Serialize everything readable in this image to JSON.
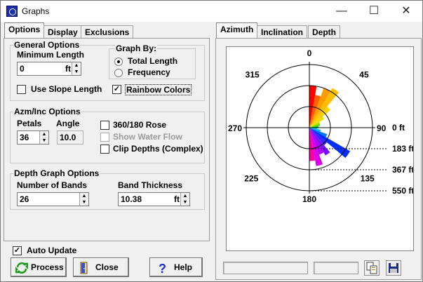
{
  "window": {
    "title": "Graphs",
    "minimize": "—",
    "maximize": "☐",
    "close": "✕"
  },
  "left_tabs": [
    "Options",
    "Display",
    "Exclusions"
  ],
  "right_tabs": [
    "Azimuth",
    "Inclination",
    "Depth"
  ],
  "general": {
    "title": "General Options",
    "min_length_label": "Minimum Length",
    "min_length_value": "0",
    "min_length_unit": "ft",
    "graph_by_title": "Graph By:",
    "graph_by_options": [
      "Total Length",
      "Frequency"
    ],
    "graph_by_selected": "Total Length",
    "use_slope_label": "Use Slope Length",
    "use_slope_checked": false,
    "rainbow_label": "Rainbow Colors",
    "rainbow_checked": true
  },
  "azminc": {
    "title": "Azm/Inc Options",
    "petals_label": "Petals",
    "petals_value": "36",
    "angle_label": "Angle",
    "angle_value": "10.0",
    "rose_label": "360/180 Rose",
    "rose_checked": false,
    "water_label": "Show Water Flow",
    "water_checked": false,
    "water_disabled": true,
    "clip_label": "Clip Depths (Complex)",
    "clip_checked": false
  },
  "depth": {
    "title": "Depth Graph Options",
    "bands_label": "Number of Bands",
    "bands_value": "26",
    "thickness_label": "Band Thickness",
    "thickness_value": "10.38",
    "thickness_unit": "ft"
  },
  "auto_update": {
    "label": "Auto Update",
    "checked": true
  },
  "buttons": {
    "process": "Process",
    "close": "Close",
    "help": "Help"
  },
  "chart_data": {
    "type": "rose",
    "angle_labels": [
      "0",
      "45",
      "90",
      "135",
      "180",
      "225",
      "270",
      "315"
    ],
    "ring_labels": [
      "0 ft",
      "183 ft",
      "367 ft",
      "550 ft"
    ],
    "petal_width_deg": 10,
    "petals": [
      {
        "azimuth_start": 0,
        "length_ft": 367,
        "color": "#ff0000"
      },
      {
        "azimuth_start": 10,
        "length_ft": 290,
        "color": "#ff6000"
      },
      {
        "azimuth_start": 20,
        "length_ft": 370,
        "color": "#ff9c00"
      },
      {
        "azimuth_start": 30,
        "length_ft": 400,
        "color": "#ffbf00"
      },
      {
        "azimuth_start": 40,
        "length_ft": 240,
        "color": "#ffd500"
      },
      {
        "azimuth_start": 50,
        "length_ft": 150,
        "color": "#e8e000"
      },
      {
        "azimuth_start": 60,
        "length_ft": 100,
        "color": "#b0e000"
      },
      {
        "azimuth_start": 70,
        "length_ft": 95,
        "color": "#50e000"
      },
      {
        "azimuth_start": 80,
        "length_ft": 80,
        "color": "#00d020"
      },
      {
        "azimuth_start": 90,
        "length_ft": 70,
        "color": "#00d8c0"
      },
      {
        "azimuth_start": 100,
        "length_ft": 100,
        "color": "#00b8ff"
      },
      {
        "azimuth_start": 110,
        "length_ft": 165,
        "color": "#0078ff"
      },
      {
        "azimuth_start": 120,
        "length_ft": 410,
        "color": "#0030ff"
      },
      {
        "azimuth_start": 130,
        "length_ft": 200,
        "color": "#4020ff"
      },
      {
        "azimuth_start": 140,
        "length_ft": 280,
        "color": "#7a10ff"
      },
      {
        "azimuth_start": 150,
        "length_ft": 250,
        "color": "#b000ff"
      },
      {
        "azimuth_start": 160,
        "length_ft": 340,
        "color": "#d800e8"
      },
      {
        "azimuth_start": 170,
        "length_ft": 290,
        "color": "#ff00a0"
      }
    ]
  }
}
